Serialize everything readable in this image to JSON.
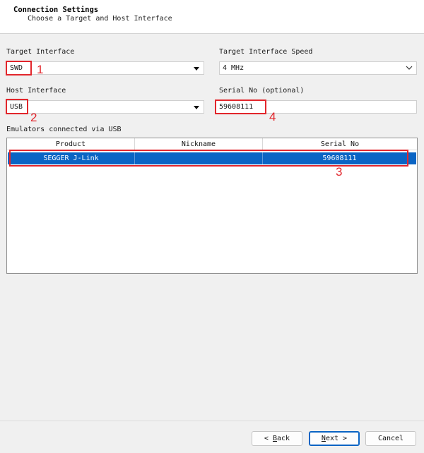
{
  "header": {
    "title": "Connection Settings",
    "subtitle": "Choose a Target and Host Interface"
  },
  "target_interface": {
    "label": "Target Interface",
    "value": "SWD"
  },
  "target_interface_speed": {
    "label": "Target Interface Speed",
    "value": "4 MHz"
  },
  "host_interface": {
    "label": "Host Interface",
    "value": "USB"
  },
  "serial_no_optional": {
    "label": "Serial No (optional)",
    "value": "59608111"
  },
  "emulators": {
    "label": "Emulators connected via USB",
    "columns": [
      "Product",
      "Nickname",
      "Serial No"
    ],
    "rows": [
      {
        "product": "SEGGER J-Link",
        "nickname": "",
        "serial": "59608111"
      }
    ]
  },
  "annotations": [
    "1",
    "2",
    "3",
    "4"
  ],
  "buttons": {
    "back": {
      "mnemonic": "B",
      "rest": "ack",
      "prefix": "< "
    },
    "next": {
      "mnemonic": "N",
      "rest": "ext",
      "suffix": " >"
    },
    "cancel": "Cancel"
  },
  "colors": {
    "selection": "#0a64c4",
    "annotation_red": "#e2262c"
  }
}
